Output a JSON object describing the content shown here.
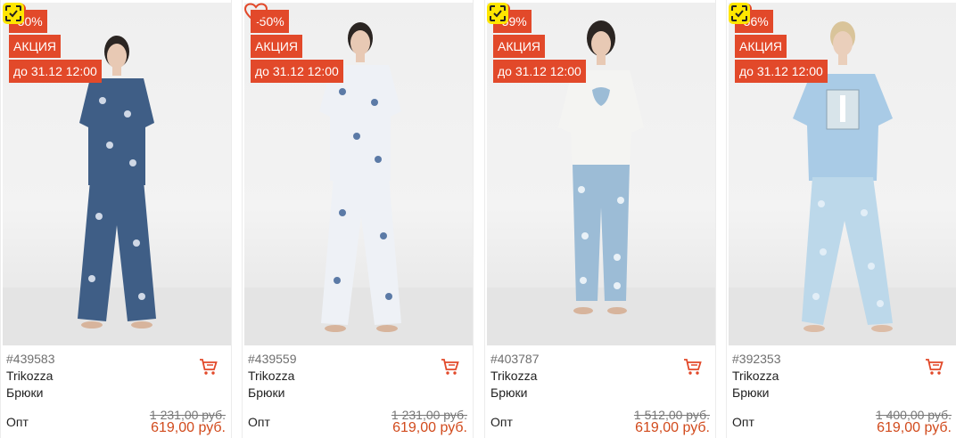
{
  "products": [
    {
      "discount": "-50%",
      "promo": "АКЦИЯ",
      "deadline": "до 31.12 12:00",
      "sku": "#439583",
      "brand": "Trikozza",
      "category": "Брюки",
      "price_label": "Опт",
      "old_price": "1 231,00 руб.",
      "price": "619,00 руб.",
      "top_color": "#3f5e86",
      "bottom_color": "#3f5e86",
      "print_color": "#cfd8e6"
    },
    {
      "discount": "-50%",
      "promo": "АКЦИЯ",
      "deadline": "до 31.12 12:00",
      "sku": "#439559",
      "brand": "Trikozza",
      "category": "Брюки",
      "price_label": "Опт",
      "old_price": "1 231,00 руб.",
      "price": "619,00 руб.",
      "top_color": "#eef1f6",
      "bottom_color": "#eef1f6",
      "print_color": "#5b7aa6"
    },
    {
      "discount": "-59%",
      "promo": "АКЦИЯ",
      "deadline": "до 31.12 12:00",
      "sku": "#403787",
      "brand": "Trikozza",
      "category": "Брюки",
      "price_label": "Опт",
      "old_price": "1 512,00 руб.",
      "price": "619,00 руб.",
      "top_color": "#f4f4f2",
      "bottom_color": "#9cbcd6",
      "print_color": "#e9f1f7"
    },
    {
      "discount": "-56%",
      "promo": "АКЦИЯ",
      "deadline": "до 31.12 12:00",
      "sku": "#392353",
      "brand": "Trikozza",
      "category": "Брюки",
      "price_label": "Опт",
      "old_price": "1 400,00 руб.",
      "price": "619,00 руб.",
      "top_color": "#a9cbe6",
      "bottom_color": "#bcd8ea",
      "print_color": "#e2eef7"
    }
  ],
  "colors": {
    "badge": "#e2492a",
    "price": "#d14a1c",
    "icon_accent": "#e2492a",
    "check_badge": "#ffe600"
  },
  "icons": {
    "favorite": "heart-icon",
    "photo_search": "scan-check-icon",
    "cart": "cart-icon"
  }
}
